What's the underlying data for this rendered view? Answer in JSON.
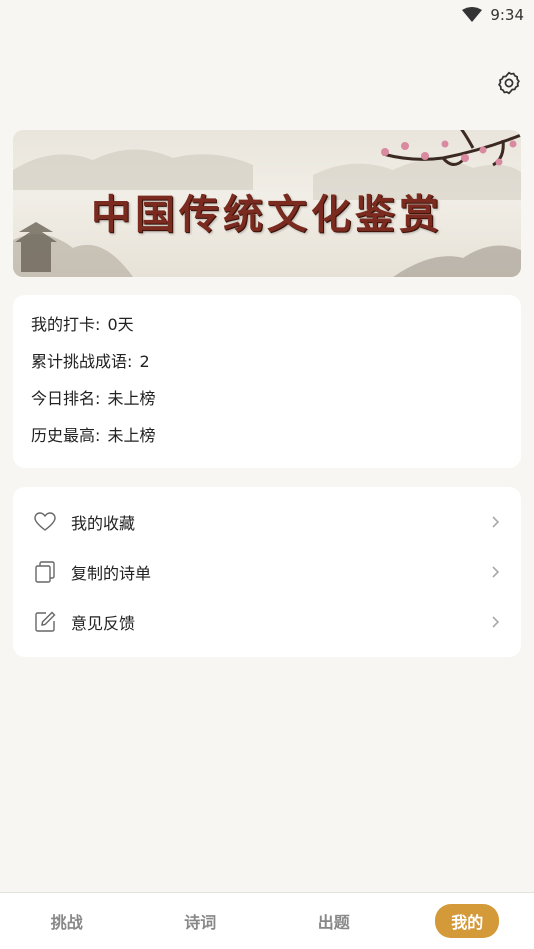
{
  "status": {
    "time": "9:34"
  },
  "banner": {
    "title": "中国传统文化鉴赏"
  },
  "stats": [
    {
      "label": "我的打卡",
      "value": "0天"
    },
    {
      "label": "累计挑战成语",
      "value": "2"
    },
    {
      "label": "今日排名",
      "value": "未上榜"
    },
    {
      "label": "历史最高",
      "value": "未上榜"
    }
  ],
  "menu": [
    {
      "label": "我的收藏",
      "icon": "heart-icon"
    },
    {
      "label": "复制的诗单",
      "icon": "copy-icon"
    },
    {
      "label": "意见反馈",
      "icon": "edit-icon"
    }
  ],
  "nav": [
    {
      "label": "挑战"
    },
    {
      "label": "诗词"
    },
    {
      "label": "出题"
    },
    {
      "label": "我的"
    }
  ],
  "colors": {
    "accent": "#d49a3a",
    "background": "#f7f6f2",
    "banner_title": "#7a2a1e"
  }
}
